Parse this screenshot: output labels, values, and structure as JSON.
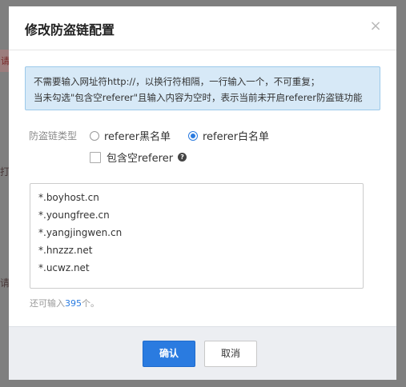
{
  "background": {
    "fragments": [
      "请",
      "打",
      "请"
    ]
  },
  "dialog": {
    "title": "修改防盗链配置",
    "close_glyph": "×",
    "notice": [
      "不需要输入网址符http://，以换行符相隔，一行输入一个，不可重复；",
      "当未勾选\"包含空referer\"且输入内容为空时，表示当前未开启referer防盗链功能"
    ],
    "type_label": "防盗链类型",
    "radio_options": [
      {
        "label": "referer黑名单",
        "checked": false
      },
      {
        "label": "referer白名单",
        "checked": true
      }
    ],
    "empty_referer": {
      "label": "包含空referer",
      "checked": false,
      "help_glyph": "?"
    },
    "domains": [
      "*.boyhost.cn",
      "*.youngfree.cn",
      "*.yangjingwen.cn",
      "*.hnzzz.net",
      "*.ucwz.net"
    ],
    "remaining": {
      "prefix": "还可输入",
      "count": "395",
      "suffix": "个。"
    },
    "buttons": {
      "ok": "确认",
      "cancel": "取消"
    }
  },
  "colors": {
    "accent": "#2a7be0",
    "notice_bg": "#d7e9f7",
    "overlay": "#7f7f7f"
  }
}
